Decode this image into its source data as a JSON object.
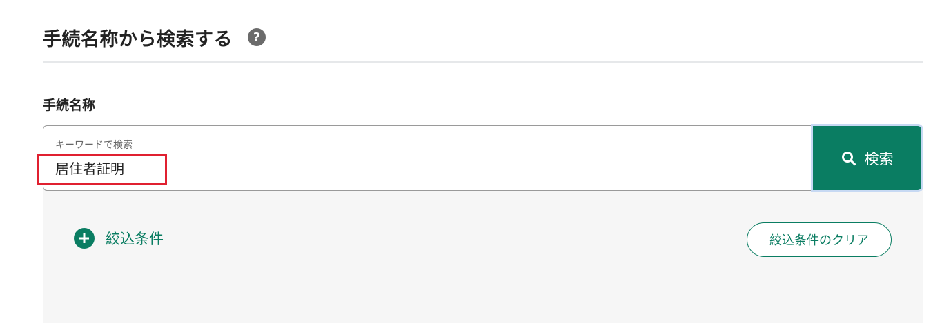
{
  "section": {
    "title": "手続名称から検索する",
    "help_icon": "question-circle-icon"
  },
  "field": {
    "label": "手続名称",
    "float_label": "キーワードで検索",
    "value": "居住者証明"
  },
  "search_button": {
    "label": "検索",
    "icon": "search-icon"
  },
  "filters": {
    "toggle_label": "絞込条件",
    "toggle_icon": "plus-circle-icon",
    "clear_label": "絞込条件のクリア"
  },
  "colors": {
    "accent": "#0a7d62",
    "highlight": "#e02030",
    "panel_bg": "#f6f6f6",
    "help_icon_bg": "#6b6b6b"
  }
}
